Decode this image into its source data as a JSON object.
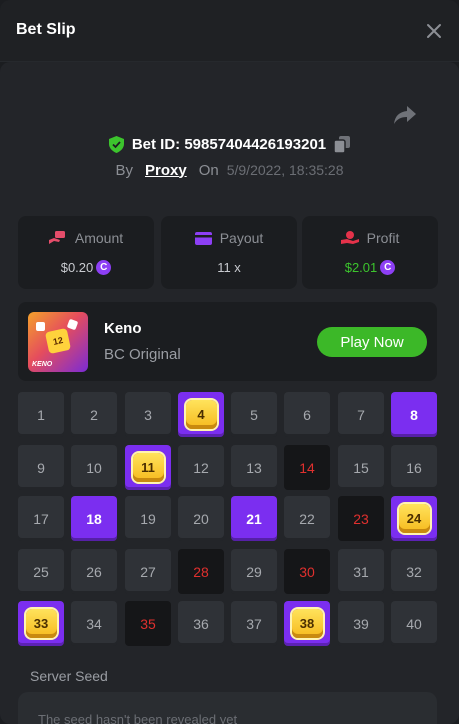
{
  "header": {
    "title": "Bet Slip"
  },
  "bet": {
    "id_label": "Bet ID: 59857404426193201",
    "by_label": "By",
    "user": "Proxy",
    "on_label": "On",
    "date": "5/9/2022, 18:35:28"
  },
  "stats": [
    {
      "label": "Amount",
      "value": "$0.20",
      "coin": true,
      "color": "#c9cbd0"
    },
    {
      "label": "Payout",
      "value": "11 x",
      "coin": false,
      "color": "#c9cbd0"
    },
    {
      "label": "Profit",
      "value": "$2.01",
      "coin": true,
      "color": "#3cc42d"
    }
  ],
  "game": {
    "name": "Keno",
    "subtitle": "BC Original",
    "play_label": "Play Now",
    "thumb_number": "12",
    "thumb_text": "KENO"
  },
  "coin_symbol": "C",
  "keno": {
    "numbers": [
      1,
      2,
      3,
      4,
      5,
      6,
      7,
      8,
      9,
      10,
      11,
      12,
      13,
      14,
      15,
      16,
      17,
      18,
      19,
      20,
      21,
      22,
      23,
      24,
      25,
      26,
      27,
      28,
      29,
      30,
      31,
      32,
      33,
      34,
      35,
      36,
      37,
      38,
      39,
      40
    ],
    "hits": [
      4,
      11,
      24,
      33,
      38
    ],
    "picked_misses": [
      8,
      18,
      21
    ],
    "drawn_misses": [
      14,
      23,
      28,
      30,
      35
    ]
  },
  "seed": {
    "label": "Server Seed",
    "text": "The seed hasn't been revealed yet"
  },
  "colors": {
    "accent_purple": "#7b2ef0",
    "play_green": "#3cb828",
    "miss_red": "#e0302e"
  }
}
